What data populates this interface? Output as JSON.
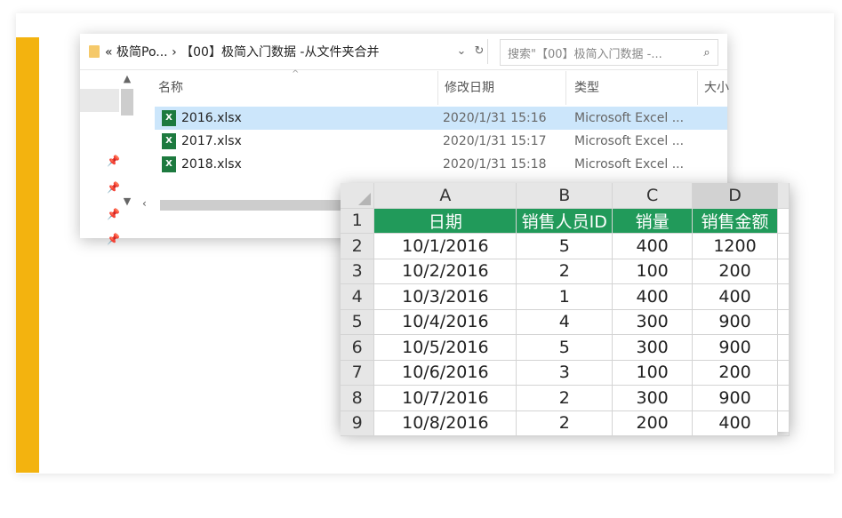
{
  "explorer": {
    "address": "« 极简Po... ›  【00】极简入门数据 -从文件夹合并",
    "dropdown_icon": "chevron-down-icon",
    "refresh_icon": "refresh-icon",
    "search_placeholder": "搜索\"【00】极简入门数据 -...",
    "search_icon": "search-icon",
    "columns": {
      "name": "名称",
      "modified": "修改日期",
      "type": "类型",
      "size": "大小"
    },
    "files": [
      {
        "name": "2016.xlsx",
        "modified": "2020/1/31 15:16",
        "type": "Microsoft Excel ...",
        "selected": true
      },
      {
        "name": "2017.xlsx",
        "modified": "2020/1/31 15:17",
        "type": "Microsoft Excel ...",
        "selected": false
      },
      {
        "name": "2018.xlsx",
        "modified": "2020/1/31 15:18",
        "type": "Microsoft Excel ...",
        "selected": false
      }
    ],
    "excel_icon_letter": "X"
  },
  "sheet": {
    "column_letters": [
      "A",
      "B",
      "C",
      "D"
    ],
    "active_column": "D",
    "row_numbers": [
      "1",
      "2",
      "3",
      "4",
      "5",
      "6",
      "7",
      "8",
      "9"
    ],
    "field_names": [
      "日期",
      "销售人员ID",
      "销量",
      "销售金额"
    ],
    "rows": [
      [
        "10/1/2016",
        "5",
        "400",
        "1200"
      ],
      [
        "10/2/2016",
        "2",
        "100",
        "200"
      ],
      [
        "10/3/2016",
        "1",
        "400",
        "400"
      ],
      [
        "10/4/2016",
        "4",
        "300",
        "900"
      ],
      [
        "10/5/2016",
        "5",
        "300",
        "900"
      ],
      [
        "10/6/2016",
        "3",
        "100",
        "200"
      ],
      [
        "10/7/2016",
        "2",
        "300",
        "900"
      ],
      [
        "10/8/2016",
        "2",
        "200",
        "400"
      ]
    ],
    "header_color": "#219a5a"
  },
  "accent_color": "#f3b30f"
}
